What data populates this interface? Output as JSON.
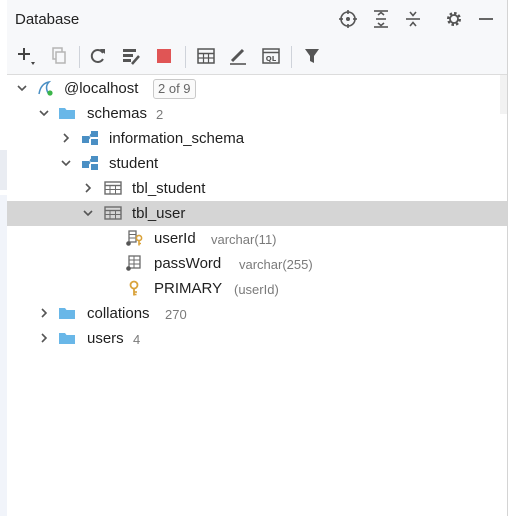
{
  "panel": {
    "title": "Database"
  },
  "header_icons": [
    "crosshair-icon",
    "expand-all-icon",
    "collapse-all-icon",
    "gear-icon",
    "minimize-icon"
  ],
  "toolbar_icons": [
    "add-icon",
    "duplicate-icon",
    "refresh-icon",
    "schema-edit-icon",
    "stop-icon",
    "table-icon",
    "edit-icon",
    "sql-console-icon",
    "filter-icon"
  ],
  "tree": {
    "host": {
      "label": "@localhost",
      "badge": "2 of 9"
    },
    "schemas": {
      "label": "schemas",
      "count": "2"
    },
    "information_schema": {
      "label": "information_schema"
    },
    "student": {
      "label": "student"
    },
    "tbl_student": {
      "label": "tbl_student"
    },
    "tbl_user": {
      "label": "tbl_user"
    },
    "col_userId": {
      "label": "userId",
      "type": "varchar(11)"
    },
    "col_passWord": {
      "label": "passWord",
      "type": "varchar(255)"
    },
    "primary": {
      "label": "PRIMARY",
      "cols": "(userId)"
    },
    "collations": {
      "label": "collations",
      "count": "270"
    },
    "users": {
      "label": "users",
      "count": "4"
    }
  },
  "colors": {
    "folder": "#69b7e8",
    "selection": "#d5d5d5",
    "key": "#d9a23a",
    "stop": "#e05555"
  }
}
